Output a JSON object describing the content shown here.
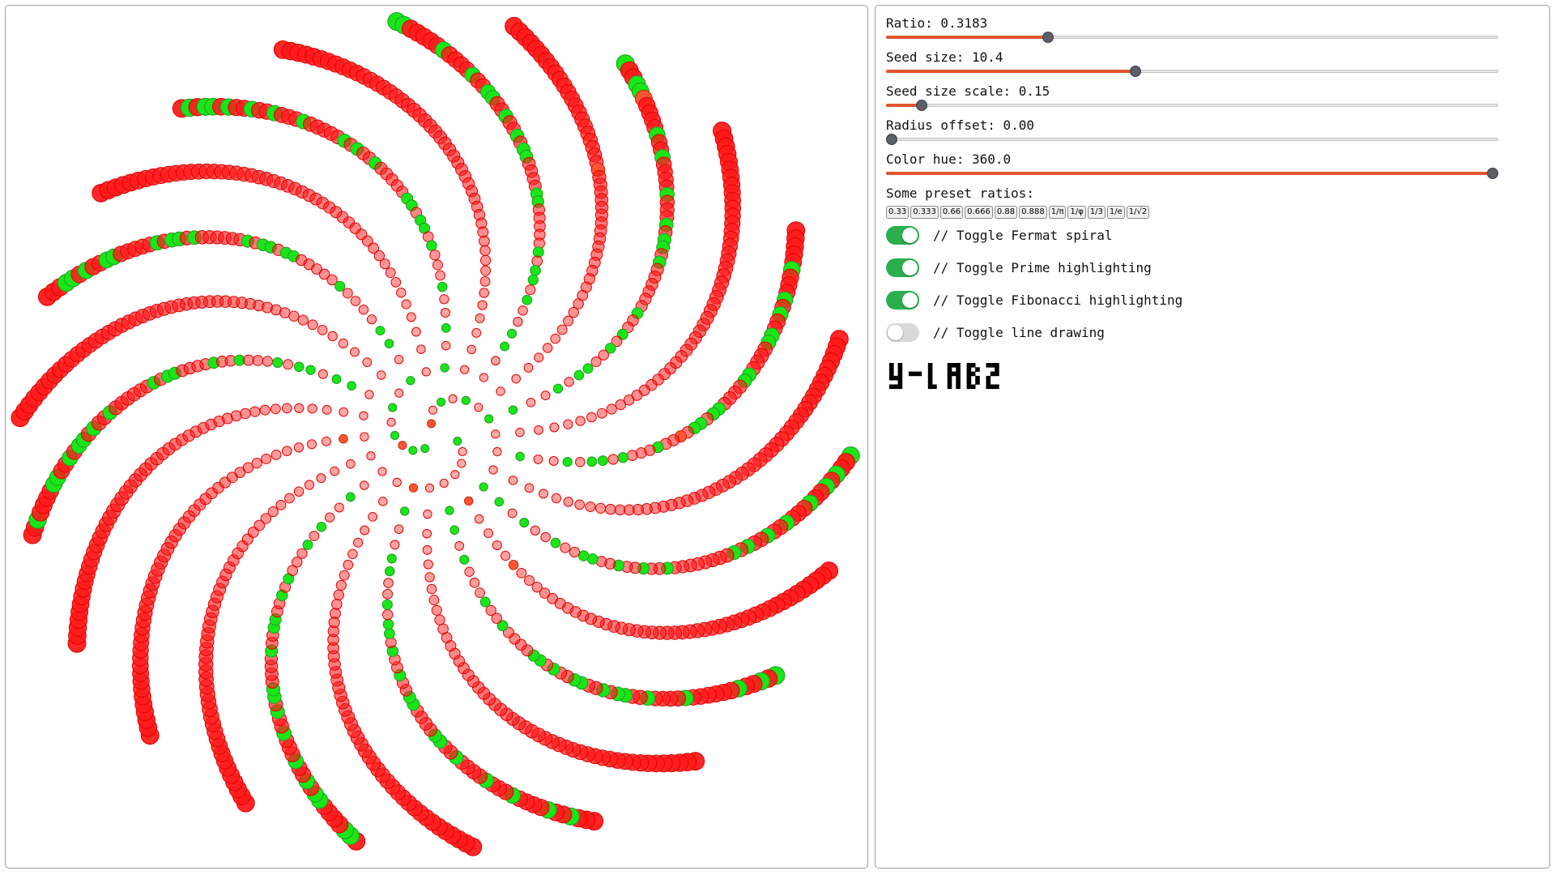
{
  "colors": {
    "accent": "#e2552d",
    "toggle_on": "#2bae4c",
    "toggle_off": "#d9d9d9",
    "seed_red": "#ff1a1a",
    "seed_green": "#19e619"
  },
  "controls": {
    "sliders": [
      {
        "label": "Ratio: 0.3183",
        "value": 0.3183,
        "fraction": 0.26
      },
      {
        "label": "Seed size: 10.4",
        "value": 10.4,
        "fraction": 0.405
      },
      {
        "label": "Seed size scale: 0.15",
        "value": 0.15,
        "fraction": 0.05
      },
      {
        "label": "Radius offset: 0.00",
        "value": 0.0,
        "fraction": 0.0
      },
      {
        "label": "Color hue: 360.0",
        "value": 360.0,
        "fraction": 1.0
      }
    ],
    "presets_label": "Some preset ratios:",
    "presets": [
      "0.33",
      "0.333",
      "0.66",
      "0.666",
      "0.88",
      "0.888",
      "1/π",
      "1/φ",
      "1/3",
      "1/e",
      "1/√2"
    ],
    "toggles": [
      {
        "label": "// Toggle Fermat spiral",
        "on": true
      },
      {
        "label": "// Toggle Prime highlighting",
        "on": true
      },
      {
        "label": "// Toggle Fibonacci highlighting",
        "on": true
      },
      {
        "label": "// Toggle line drawing",
        "on": false
      }
    ],
    "logo_text": "y-lab2"
  },
  "spiral": {
    "ratio": 0.3183,
    "seed_count": 1100,
    "prime_highlight": true,
    "fibonacci_highlight": true,
    "fermat": true,
    "line_drawing": false
  }
}
